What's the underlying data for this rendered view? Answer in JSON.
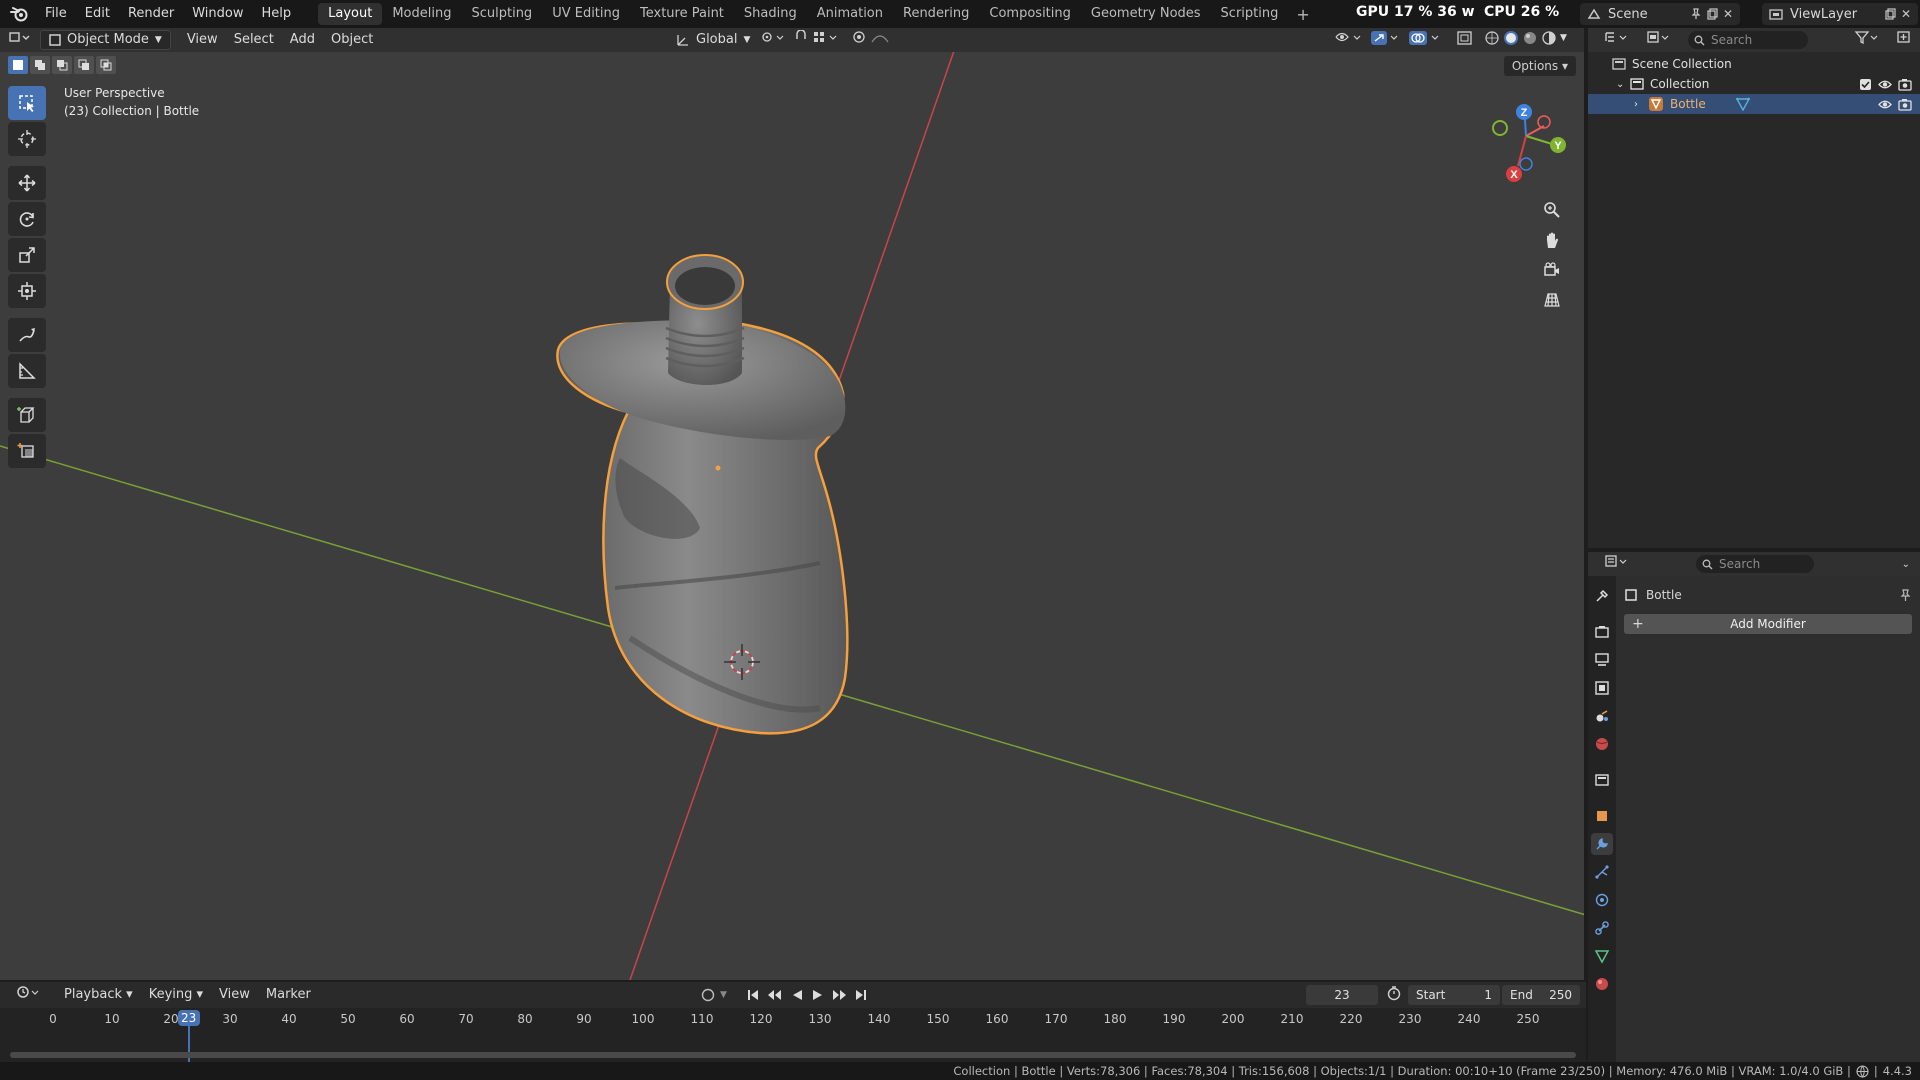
{
  "topbar": {
    "menus": [
      "File",
      "Edit",
      "Render",
      "Window",
      "Help"
    ],
    "workspaces": [
      "Layout",
      "Modeling",
      "Sculpting",
      "UV Editing",
      "Texture Paint",
      "Shading",
      "Animation",
      "Rendering",
      "Compositing",
      "Geometry Nodes",
      "Scripting"
    ],
    "add_symbol": "+",
    "gpu_stat": "GPU  17 %  36 w",
    "cpu_stat": "CPU  26 %",
    "scene_name": "Scene",
    "view_layer": "ViewLayer"
  },
  "viewport": {
    "mode": "Object Mode",
    "menus": [
      "View",
      "Select",
      "Add",
      "Object"
    ],
    "transform_orientation": "Global",
    "options_label": "Options",
    "view_name": "User Perspective",
    "view_context": "(23) Collection | Bottle",
    "gizmo": {
      "x": "X",
      "y": "Y",
      "z": "Z"
    }
  },
  "timeline": {
    "menus": [
      "Playback",
      "Keying",
      "View",
      "Marker"
    ],
    "current_frame": "23",
    "start_label": "Start",
    "start_value": "1",
    "end_label": "End",
    "end_value": "250",
    "ticks": [
      "0",
      "10",
      "20",
      "30",
      "40",
      "50",
      "60",
      "70",
      "80",
      "90",
      "100",
      "110",
      "120",
      "130",
      "140",
      "150",
      "160",
      "170",
      "180",
      "190",
      "200",
      "210",
      "220",
      "230",
      "240",
      "250"
    ]
  },
  "outliner": {
    "search_placeholder": "Search",
    "root": "Scene Collection",
    "collection": "Collection",
    "object": "Bottle"
  },
  "properties": {
    "search_placeholder": "Search",
    "object_name": "Bottle",
    "add_modifier": "Add Modifier"
  },
  "statusbar": {
    "text": "Collection | Bottle | Verts:78,306 | Faces:78,304 | Tris:156,608 | Objects:1/1 | Duration: 00:10+10 (Frame 23/250) | Memory: 476.0 MiB | VRAM: 1.0/4.0 GiB | ",
    "version": "4.4.3"
  },
  "colors": {
    "accent": "#4772b3",
    "selection_outline": "#f5a03c",
    "axis_x": "#d9403f",
    "axis_y": "#82b433",
    "axis_z": "#3f82e0"
  }
}
